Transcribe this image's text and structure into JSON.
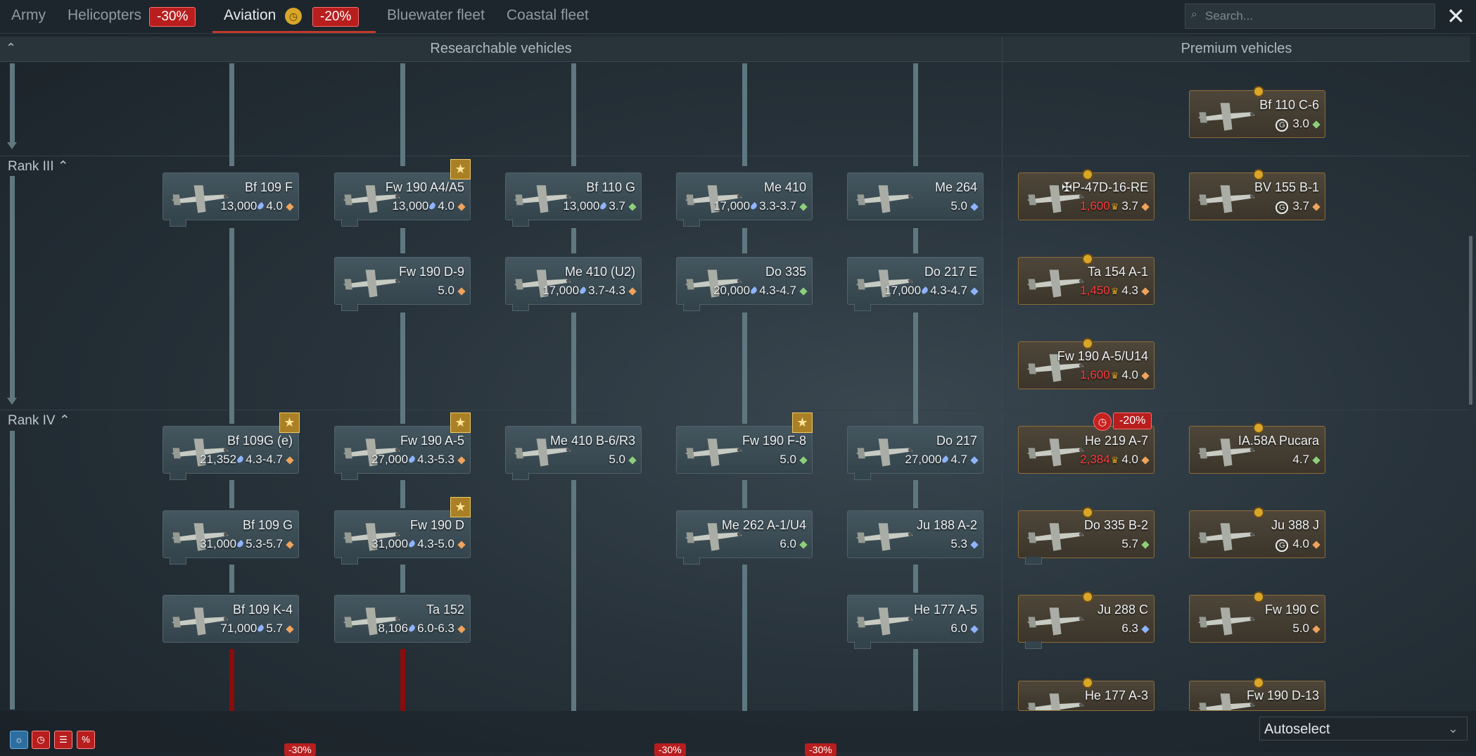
{
  "tabs": [
    {
      "label": "Army"
    },
    {
      "label": "Helicopters",
      "discount": "-30%"
    },
    {
      "label": "Aviation",
      "discount": "-20%"
    },
    {
      "label": "Bluewater fleet"
    },
    {
      "label": "Coastal fleet"
    }
  ],
  "search": {
    "placeholder": "Search..."
  },
  "columns": {
    "researchable": "Researchable vehicles",
    "premium": "Premium vehicles"
  },
  "ranks": [
    "Rank III",
    "Rank IV"
  ],
  "vehicles": {
    "bf110c6": {
      "name": "Bf 110 C-6",
      "br": "3.0"
    },
    "bf109f": {
      "name": "Bf 109 F",
      "rp": "13,000",
      "br": "4.0"
    },
    "fw190a4": {
      "name": "Fw 190 A4/A5",
      "rp": "13,000",
      "br": "4.0"
    },
    "bf110g": {
      "name": "Bf 110 G",
      "rp": "13,000",
      "br": "3.7"
    },
    "me410": {
      "name": "Me 410",
      "rp": "17,000",
      "br": "3.3-3.7"
    },
    "me264": {
      "name": "Me 264",
      "br": "5.0"
    },
    "p47d": {
      "name": "✠P-47D-16-RE",
      "price": "1,600",
      "br": "3.7"
    },
    "bv155": {
      "name": "BV 155 B-1",
      "br": "3.7"
    },
    "fw190d9": {
      "name": "Fw 190 D-9",
      "br": "5.0"
    },
    "me410u2": {
      "name": "Me 410 (U2)",
      "rp": "17,000",
      "br": "3.7-4.3"
    },
    "do335": {
      "name": "Do 335",
      "rp": "20,000",
      "br": "4.3-4.7"
    },
    "do217e": {
      "name": "Do 217 E",
      "rp": "17,000",
      "br": "4.3-4.7"
    },
    "ta154": {
      "name": "Ta 154 A-1",
      "price": "1,450",
      "br": "4.3"
    },
    "fw190u14": {
      "name": "Fw 190 A-5/U14",
      "price": "1,600",
      "br": "4.0"
    },
    "bf109ge": {
      "name": "Bf 109G (e)",
      "rp": "21,352",
      "br": "4.3-4.7"
    },
    "fw190a5": {
      "name": "Fw 190 A-5",
      "rp": "27,000",
      "br": "4.3-5.3"
    },
    "me410b6": {
      "name": "Me 410 B-6/R3",
      "br": "5.0"
    },
    "fw190f8": {
      "name": "Fw 190 F-8",
      "br": "5.0"
    },
    "do217": {
      "name": "Do 217",
      "rp": "27,000",
      "br": "4.7"
    },
    "he219": {
      "name": "He 219 A-7",
      "price": "2,384",
      "br": "4.0",
      "discount": "-20%"
    },
    "ja58": {
      "name": "IA.58A Pucara",
      "br": "4.7"
    },
    "bf109g": {
      "name": "Bf 109 G",
      "rp": "31,000",
      "br": "5.3-5.7"
    },
    "fw190d": {
      "name": "Fw 190 D",
      "rp": "31,000",
      "br": "4.3-5.0"
    },
    "me262": {
      "name": "Me 262 A-1/U4",
      "br": "6.0"
    },
    "ju188": {
      "name": "Ju 188 A-2",
      "br": "5.3"
    },
    "do335b2": {
      "name": "Do 335 B-2",
      "br": "5.7"
    },
    "ju388": {
      "name": "Ju 388 J",
      "br": "4.0"
    },
    "bf109k4": {
      "name": "Bf 109 K-4",
      "rp": "71,000",
      "br": "5.7"
    },
    "ta152": {
      "name": "Ta 152",
      "rp": "8,106",
      "br": "6.0-6.3"
    },
    "he177a5": {
      "name": "He 177 A-5",
      "br": "6.0"
    },
    "ju288c": {
      "name": "Ju 288 C",
      "br": "6.3"
    },
    "fw190c": {
      "name": "Fw 190 C",
      "br": "5.0"
    },
    "he177a3": {
      "name": "He 177 A-3"
    },
    "fw190d13": {
      "name": "Fw 190 D-13"
    }
  },
  "footer": {
    "autoselect": "Autoselect",
    "peek_discounts": [
      "-30%",
      "-30%",
      "-30%"
    ]
  },
  "colors": {
    "accent_red": "#b81e1e",
    "premium_gold": "#d8a629",
    "fighter": "#f0a35c",
    "attacker": "#8ed07a",
    "bomber": "#8fb4ff"
  },
  "icons": [
    "close-icon",
    "search-icon",
    "clock-icon",
    "star-icon",
    "diamond-icon",
    "rp-drop-icon",
    "golden-eagle-icon",
    "gift-icon",
    "chevron-up-icon",
    "chevron-down-icon"
  ]
}
